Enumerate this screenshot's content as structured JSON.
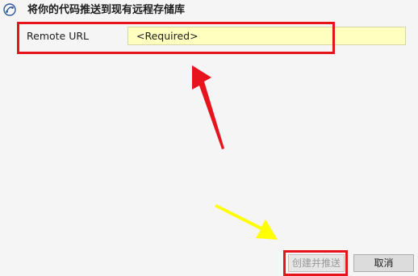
{
  "header": {
    "title": "将你的代码推送到现有远程存储库",
    "icon": "git-branch-icon"
  },
  "form": {
    "remote_url_label": "Remote URL",
    "remote_url_placeholder": "<Required>",
    "remote_url_value": ""
  },
  "buttons": {
    "create_push_label": "创建并推送",
    "cancel_label": "取消"
  },
  "colors": {
    "input_background": "#ffffc0",
    "annotation_red": "#e8141d",
    "annotation_yellow": "#ffff00"
  }
}
